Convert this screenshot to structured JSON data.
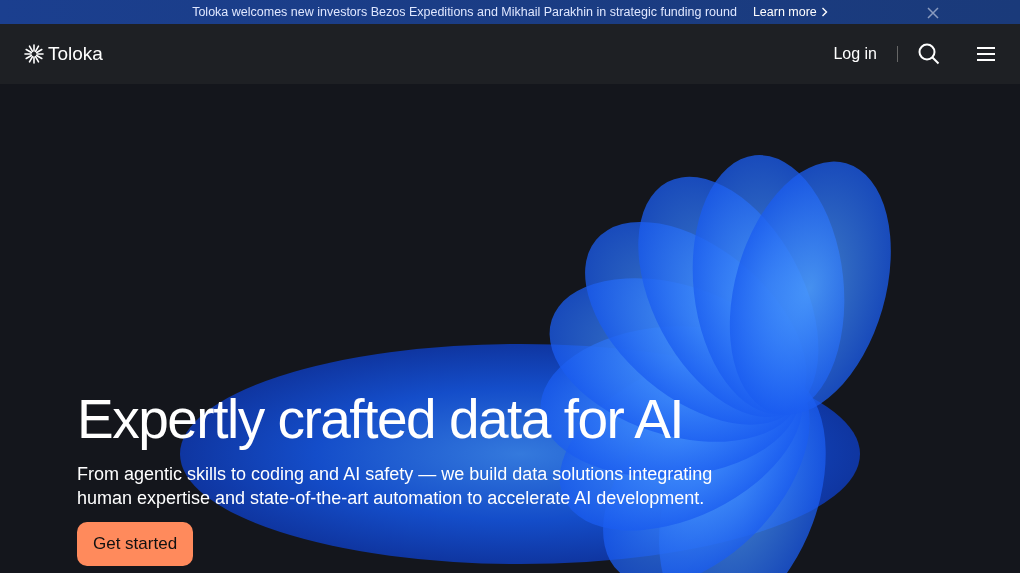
{
  "announcement": {
    "text": "Toloka welcomes new investors Bezos Expeditions and Mikhail Parakhin in strategic funding round",
    "link": "Learn more"
  },
  "navbar": {
    "brand": "Toloka",
    "login": "Log in"
  },
  "hero": {
    "title": "Expertly crafted data for AI",
    "subtitle": "From agentic skills to coding and AI safety — we build data solutions integrating human expertise and state-of-the-art automation to accelerate AI development.",
    "button": "Get started"
  }
}
